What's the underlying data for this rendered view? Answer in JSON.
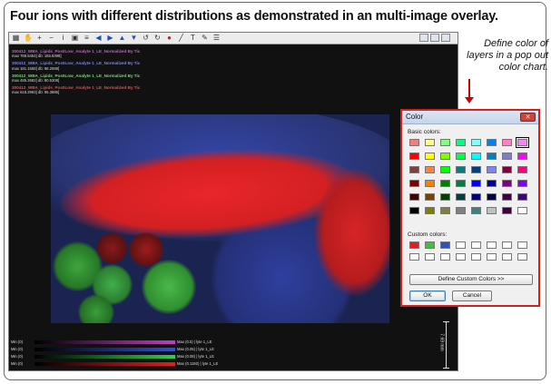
{
  "caption": "Four ions with different distributions as demonstrated in an multi-image overlay.",
  "annotation": "Define color of layers in a pop out color chart.",
  "toolbar": {
    "icons": [
      "grid-icon",
      "hand-icon",
      "zoom-in-icon",
      "zoom-out-icon",
      "info-icon",
      "image-icon",
      "layers-icon",
      "arrow-left-icon",
      "arrow-right-icon",
      "arrow-up-icon",
      "arrow-down-icon",
      "rotate-left-icon",
      "rotate-right-icon",
      "record-icon",
      "line-icon",
      "text-icon",
      "pencil-icon",
      "list-icon"
    ],
    "right_icons": [
      "layout-icon",
      "color-icon",
      "pointer-icon"
    ]
  },
  "layers": [
    {
      "title": "300412_WBA_Lipids_Pos0Low_Analyte 1_LE_Normalized By Tic",
      "subtitle": "max 788.5454] db: 155.8398]",
      "color": "#c060c0"
    },
    {
      "title": "300412_WBA_Lipids_Pos0Low_Analyte 1_LE_Normalized By Tic",
      "subtitle": "max 181.1558] db: 98.2588]",
      "color": "#7a86d8"
    },
    {
      "title": "300412_WBA_Lipids_Pos0Low_Analyte 1_LE_Normalized By Tic",
      "subtitle": "max 485.2682] db: 80.5308]",
      "color": "#7fd07f"
    },
    {
      "title": "300412_WBA_Lipids_Pos0Low_Analyte 1_LE_Normalized By Tic",
      "subtitle": "max 618.2993] db: 95.3885]",
      "color": "#e05050"
    }
  ],
  "colorbars": [
    {
      "min": "Min (0)",
      "max": "Max (0.5) | lyte 1_LE",
      "color": "#c040c0"
    },
    {
      "min": "Min (0)",
      "max": "Max (0.05) | lyte 1_LE",
      "color": "#3050d0"
    },
    {
      "min": "Min (0)",
      "max": "Max (0.08) | lyte 1_LE",
      "color": "#30d050"
    },
    {
      "min": "Min (0)",
      "max": "Max (0.1192) | lyte 1_LE",
      "color": "#e02020"
    }
  ],
  "scalebar": {
    "label": "7.69 mm"
  },
  "dialog": {
    "title": "Color",
    "close_label": "✕",
    "basic_label": "Basic colors:",
    "custom_label": "Custom colors:",
    "define_button": "Define Custom Colors >>",
    "ok_button": "OK",
    "cancel_button": "Cancel",
    "basic_colors": [
      "#f08080",
      "#ffff80",
      "#80ff80",
      "#00ff80",
      "#80ffff",
      "#0080ff",
      "#ff80c0",
      "#ff80ff",
      "#ff0000",
      "#ffff00",
      "#80ff00",
      "#00ff40",
      "#00ffff",
      "#0080c0",
      "#8080c0",
      "#ff00ff",
      "#804040",
      "#ff8040",
      "#00ff00",
      "#008080",
      "#004080",
      "#8080ff",
      "#800040",
      "#ff0080",
      "#800000",
      "#ff8000",
      "#008000",
      "#008040",
      "#0000ff",
      "#0000a0",
      "#800080",
      "#8000ff",
      "#400000",
      "#804000",
      "#004000",
      "#004040",
      "#000080",
      "#000040",
      "#400040",
      "#400080",
      "#000000",
      "#808000",
      "#808040",
      "#808080",
      "#408080",
      "#c0c0c0",
      "#400040",
      "#ffffff"
    ],
    "selected_basic_index": 7,
    "custom_colors": [
      "#e02020",
      "#40c040",
      "#3050c0",
      "#ffffff",
      "#ffffff",
      "#ffffff",
      "#ffffff",
      "#ffffff",
      "#ffffff",
      "#ffffff",
      "#ffffff",
      "#ffffff",
      "#ffffff",
      "#ffffff",
      "#ffffff",
      "#ffffff"
    ]
  }
}
